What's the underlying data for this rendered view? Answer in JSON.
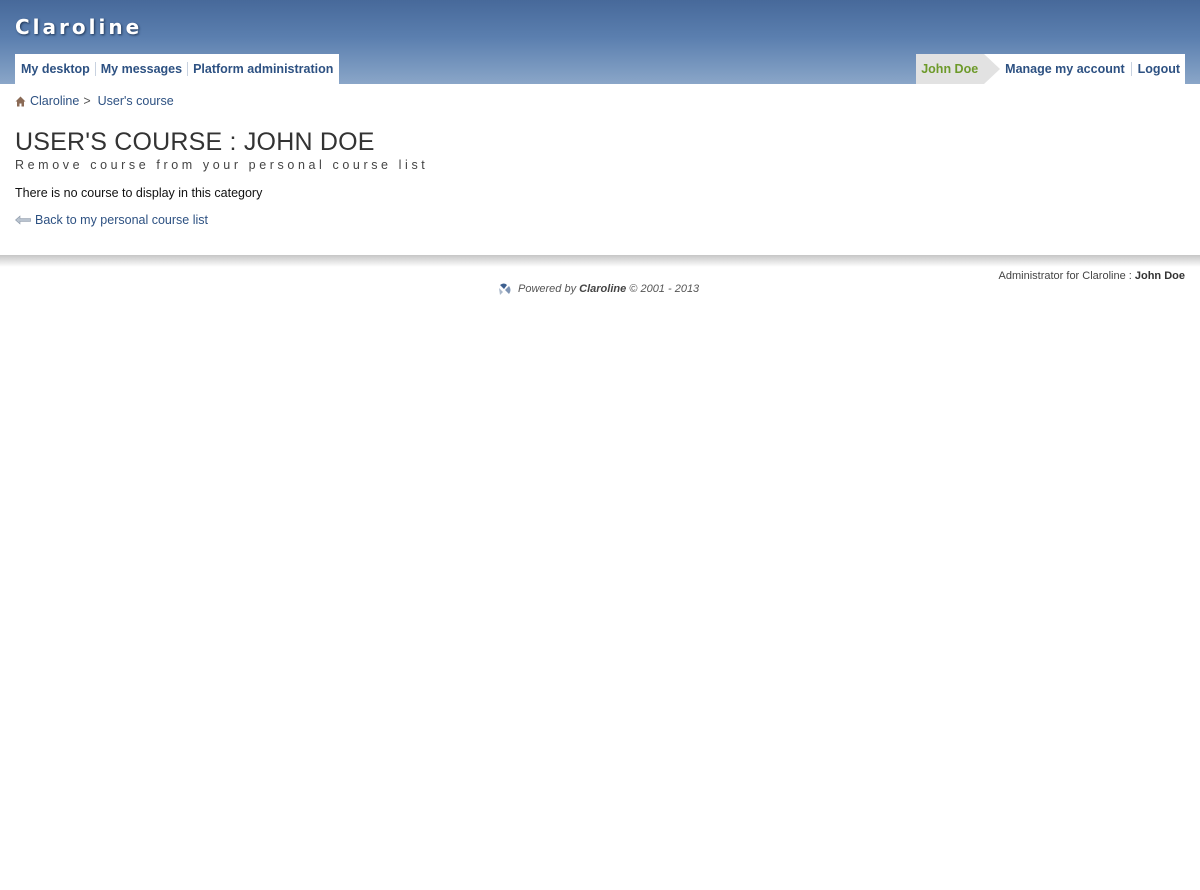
{
  "header": {
    "brand": "Claroline",
    "nav_left": [
      "My desktop",
      "My messages",
      "Platform administration"
    ],
    "user_name": "John Doe",
    "nav_right": [
      "Manage my account",
      "Logout"
    ]
  },
  "breadcrumb": {
    "home": "Claroline",
    "separator": ">",
    "current": "User's course"
  },
  "main": {
    "title": "USER'S COURSE : JOHN DOE",
    "subtitle": "Remove course from your personal course list",
    "message": "There is no course to display in this category",
    "back_link": "Back to my personal course list"
  },
  "footer": {
    "admin_label": "Administrator for Claroline :",
    "admin_name": "John Doe",
    "powered_prefix": "Powered by",
    "powered_brand": "Claroline",
    "powered_suffix": "© 2001 - 2013"
  },
  "colors": {
    "header_blue": "#47699a",
    "link_blue": "#2d5182",
    "user_green": "#6d9a2a"
  },
  "icons": [
    "home-icon",
    "back-arrow-icon",
    "claroline-logo-icon"
  ]
}
